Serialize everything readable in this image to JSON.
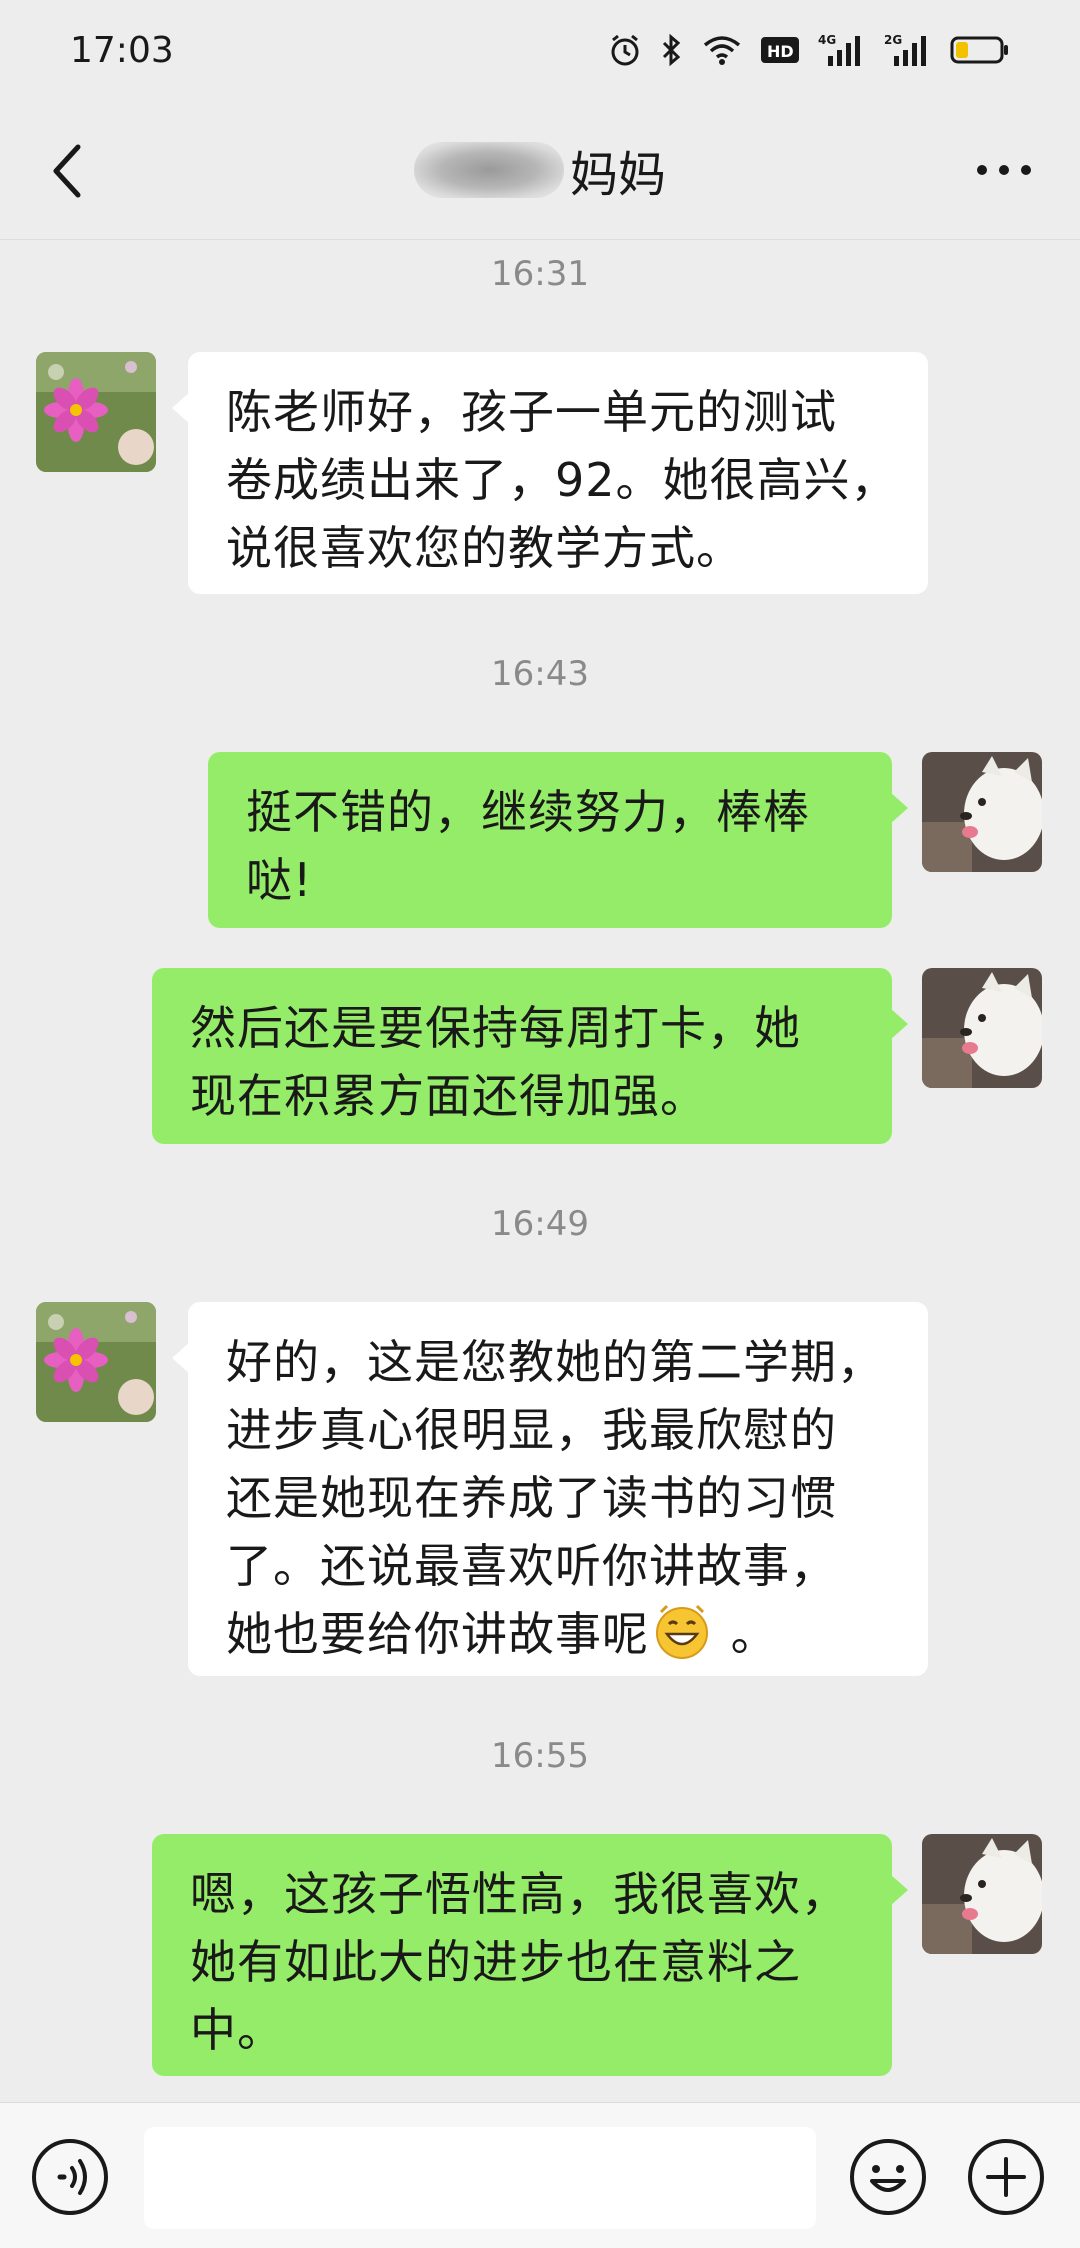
{
  "status_bar": {
    "time": "17:03",
    "icons": [
      "alarm-icon",
      "bluetooth-icon",
      "wifi-icon",
      "hd-icon",
      "signal-4g-icon",
      "signal-2g-icon",
      "battery-icon"
    ],
    "hd_label": "HD",
    "net1_label": "4G",
    "net2_label": "2G"
  },
  "header": {
    "title": "妈妈"
  },
  "messages": [
    {
      "time": "16:31"
    },
    {
      "side": "left",
      "lines": [
        "陈老师好，孩子一单元的测试",
        "卷成绩出来了，92。她很高兴，",
        "说很喜欢您的教学方式。"
      ]
    },
    {
      "time": "16:43"
    },
    {
      "side": "right",
      "lines": [
        "挺不错的，继续努力，棒棒",
        "哒!"
      ]
    },
    {
      "side": "right",
      "lines": [
        "然后还是要保持每周打卡，她",
        "现在积累方面还得加强。"
      ]
    },
    {
      "time": "16:49"
    },
    {
      "side": "left",
      "lines": [
        "好的，这是您教她的第二学期，",
        "进步真心很明显，我最欣慰的",
        "还是她现在养成了读书的习惯",
        "了。还说最喜欢听你讲故事，",
        "她也要给你讲故事呢"
      ],
      "last_line_suffix": " 。"
    },
    {
      "time": "16:55"
    },
    {
      "side": "right",
      "lines": [
        "嗯，这孩子悟性高，我很喜欢，",
        "她有如此大的进步也在意料之",
        "中。"
      ]
    }
  ],
  "input_bar": {
    "value": "",
    "icons": [
      "voice-icon",
      "emoji-icon",
      "plus-icon"
    ]
  },
  "colors": {
    "background": "#ededed",
    "bubble_self": "#95ec69",
    "bubble_other": "#ffffff",
    "timestamp": "#8a8a8a"
  }
}
